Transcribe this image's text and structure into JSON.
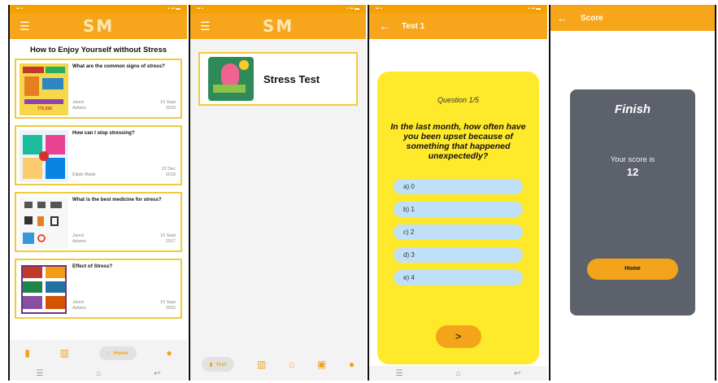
{
  "screen1": {
    "logo": "SM",
    "heading": "How to Enjoy Yourself without Stress",
    "articles": [
      {
        "title": "What are the common signs of stress?",
        "author": "Jared Adams",
        "date": "15 Sept 2019",
        "thumb_caption": "775,000"
      },
      {
        "title": "How can I stop stressing?",
        "author": "Elijah Made",
        "date": "22 Dec 2018"
      },
      {
        "title": "What is the best medicine for stress?",
        "author": "Jared Adams",
        "date": "15 Sept 2017"
      },
      {
        "title": "Effect of Stress?",
        "author": "Jared Adams",
        "date": "15 Sept 2015"
      }
    ],
    "nav": {
      "home_label": "Home"
    },
    "colors": {
      "accent": "#f7a51a",
      "card_border": "#f0cc3a"
    }
  },
  "screen2": {
    "logo": "SM",
    "test_title": "Stress Test",
    "nav": {
      "test_label": "Test"
    }
  },
  "screen3": {
    "title": "Test 1",
    "question_number": "Question 1/5",
    "question": "In the last month, how often have you been upset because of something that  happened unexpectedly?",
    "options": [
      "a)  0",
      "b)  1",
      "c)  2",
      "d)  3",
      "e)  4"
    ],
    "next_label": ">",
    "colors": {
      "card": "#ffe92b",
      "option": "#bfe0f6"
    }
  },
  "screen4": {
    "title": "Score",
    "finish": "Finish",
    "score_label": "Your score is",
    "score_value": "12",
    "home_label": "Home",
    "colors": {
      "card": "#5c616c"
    }
  }
}
